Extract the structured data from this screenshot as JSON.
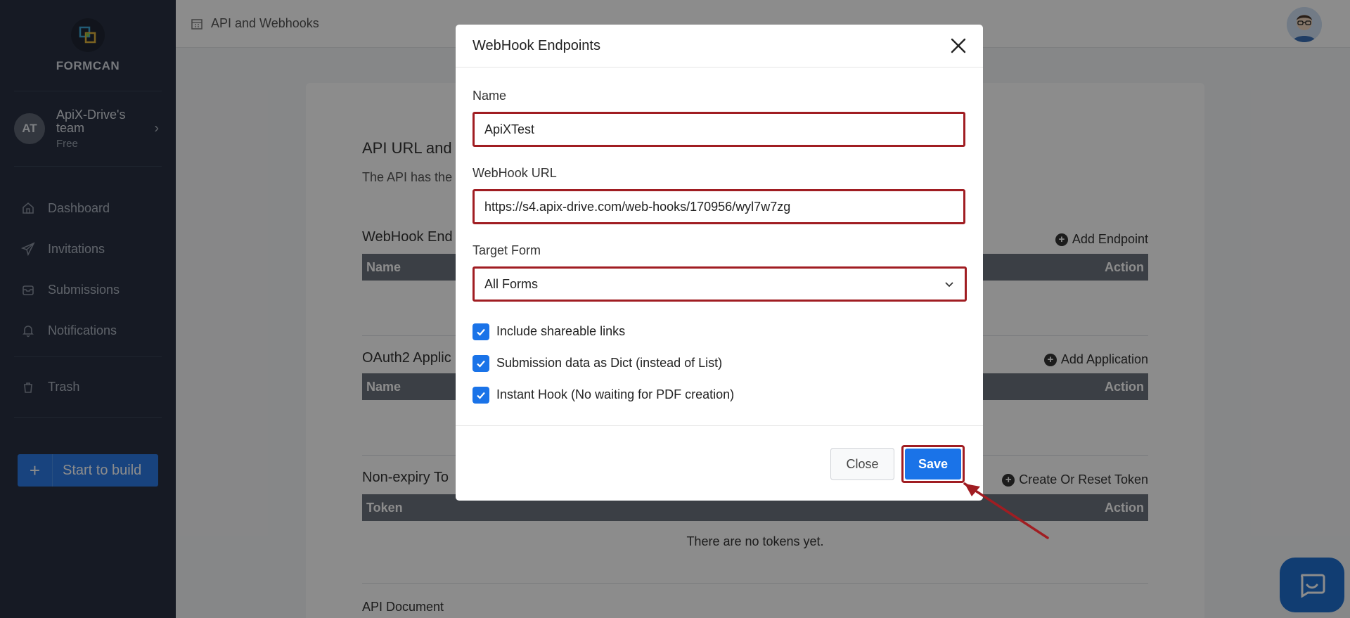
{
  "app": {
    "brand": "FORMCAN"
  },
  "sidebar": {
    "team": {
      "initials": "AT",
      "name": "ApiX-Drive's team",
      "plan": "Free"
    },
    "items": [
      {
        "label": "Dashboard",
        "icon": "home-icon"
      },
      {
        "label": "Invitations",
        "icon": "paper-plane-icon"
      },
      {
        "label": "Submissions",
        "icon": "inbox-icon"
      },
      {
        "label": "Notifications",
        "icon": "bell-icon"
      }
    ],
    "trash": {
      "label": "Trash",
      "icon": "trash-icon"
    },
    "build_button": {
      "plus": "+",
      "label": "Start to build"
    }
  },
  "topbar": {
    "title": "API and Webhooks"
  },
  "main": {
    "api_title": "API URL and",
    "api_sub": "The API has the",
    "webhook_section": {
      "title": "WebHook End",
      "add": "Add Endpoint",
      "col_name": "Name",
      "col_action": "Action"
    },
    "oauth_section": {
      "title": "OAuth2 Applic",
      "add": "Add Application",
      "col_name": "Name",
      "col_action": "Action"
    },
    "token_section": {
      "title": "Non-expiry To",
      "add": "Create Or Reset Token",
      "col_token": "Token",
      "col_action": "Action",
      "empty": "There are no tokens yet."
    },
    "api_doc": "API Document"
  },
  "modal": {
    "title": "WebHook Endpoints",
    "name_label": "Name",
    "name_value": "ApiXTest",
    "url_label": "WebHook URL",
    "url_value": "https://s4.apix-drive.com/web-hooks/170956/wyl7w7zg",
    "target_label": "Target Form",
    "target_value": "All Forms",
    "checks": [
      {
        "label": "Include shareable links",
        "checked": true
      },
      {
        "label": "Submission data as Dict (instead of List)",
        "checked": true
      },
      {
        "label": "Instant Hook (No waiting for PDF creation)",
        "checked": true
      }
    ],
    "close_label": "Close",
    "save_label": "Save"
  },
  "colors": {
    "accent": "#1a73e8",
    "highlight": "#a01d22",
    "sidebar": "#283142"
  }
}
